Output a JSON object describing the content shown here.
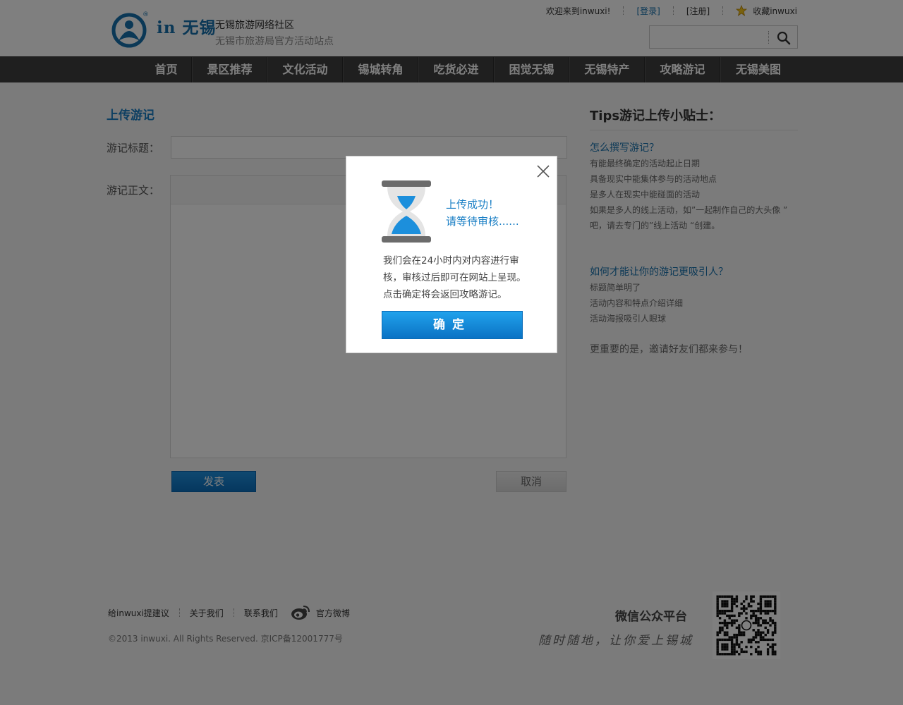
{
  "header": {
    "logo_text": "in 无锡",
    "logo_reg": "®",
    "site_name": "无锡旅游网络社区",
    "site_sub": "无锡市旅游局官方活动站点",
    "welcome": "欢迎来到inwuxi!",
    "login": "[登录]",
    "register": "[注册]",
    "favorite": "收藏inwuxi",
    "search_value": ""
  },
  "nav": {
    "items": [
      "首页",
      "景区推荐",
      "文化活动",
      "锡城转角",
      "吃货必进",
      "困觉无锡",
      "无锡特产",
      "攻略游记",
      "无锡美图"
    ]
  },
  "form": {
    "page_title": "上传游记",
    "title_label": "游记标题：",
    "title_value": "",
    "body_label": "游记正文：",
    "publish": "发表",
    "cancel": "取消"
  },
  "tips": {
    "title": "Tips游记上传小贴士：",
    "q1": "怎么撰写游记？",
    "q1_items": [
      "有能最终确定的活动起止日期",
      "具备现实中能集体参与的活动地点",
      "是多人在现实中能碰面的活动",
      "如果是多人的线上活动，如”一起制作自己的大头像 ”",
      "吧，请去专门的”线上活动 “创建。"
    ],
    "q2": "如何才能让你的游记更吸引人？",
    "q2_items": [
      "标题简单明了",
      "活动内容和特点介绍详细",
      "活动海报吸引人眼球"
    ],
    "more": "更重要的是，邀请好友们都来参与！"
  },
  "footer": {
    "links": [
      "给inwuxi提建议",
      "关于我们",
      "联系我们"
    ],
    "weibo": "官方微博",
    "copyright": "©2013 inwuxi. All Rights Reserved. 京ICP备12001777号",
    "wechat_title": "微信公众平台",
    "wechat_slogan": "随时随地，让你爱上锡城"
  },
  "modal": {
    "title_line1": "上传成功！",
    "title_line2": "请等待审核......",
    "body": "我们会在24小时内对内容进行审核，审核过后即可在网站上呈现。点击确定将会返回攻略游记。",
    "ok": "确定"
  },
  "colors": {
    "accent": "#1a7fc5",
    "nav_bg": "#3f3f3f",
    "button_blue": "#0b6fbd"
  }
}
